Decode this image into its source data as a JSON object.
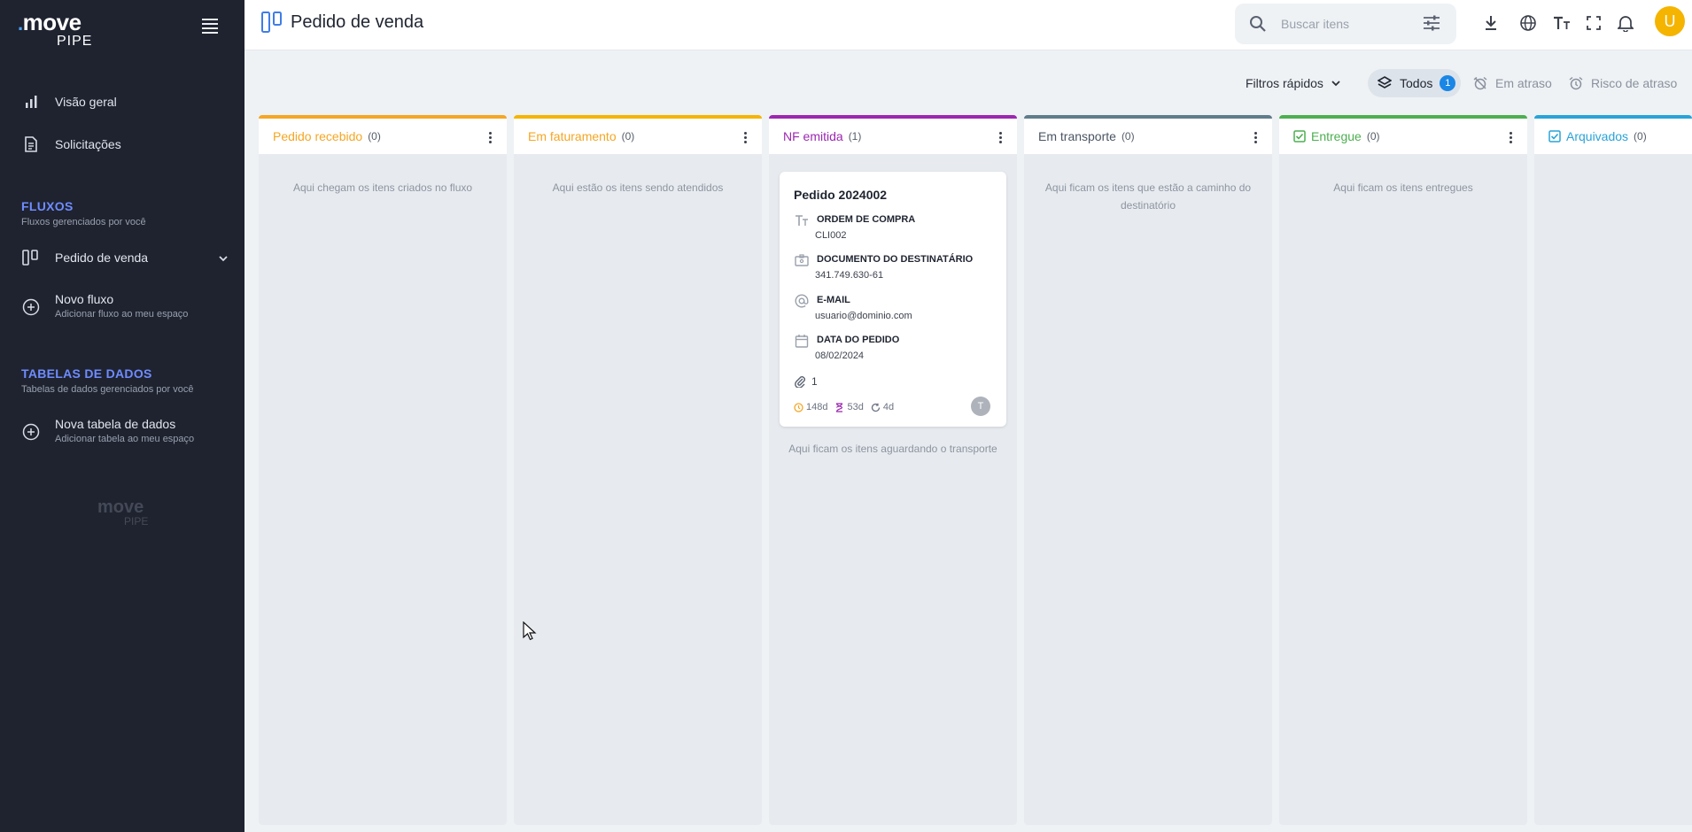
{
  "sidebar": {
    "logo_main": "move",
    "logo_sub": "PIPE",
    "nav": [
      {
        "label": "Visão geral",
        "icon": "bar-chart-icon"
      },
      {
        "label": "Solicitações",
        "icon": "document-icon"
      }
    ],
    "fluxos": {
      "title": "FLUXOS",
      "subtitle": "Fluxos gerenciados por você",
      "items": [
        {
          "label": "Pedido de venda",
          "icon": "kanban-icon"
        }
      ],
      "new": {
        "label": "Novo fluxo",
        "sub": "Adicionar fluxo ao meu espaço"
      }
    },
    "tabelas": {
      "title": "TABELAS DE DADOS",
      "subtitle": "Tabelas de dados gerenciados por você",
      "new": {
        "label": "Nova tabela de dados",
        "sub": "Adicionar tabela ao meu espaço"
      }
    },
    "footer_logo_main": "move",
    "footer_logo_sub": "PIPE"
  },
  "header": {
    "title": "Pedido de venda",
    "search_placeholder": "Buscar itens",
    "avatar_initial": "U"
  },
  "filters": {
    "quick_label": "Filtros rápidos",
    "chips": [
      {
        "label": "Todos",
        "count": "1",
        "active": true
      },
      {
        "label": "Em atraso",
        "active": false
      },
      {
        "label": "Risco de atraso",
        "active": false
      }
    ]
  },
  "columns": [
    {
      "title": "Pedido recebido",
      "count": "(0)",
      "color": "#f5a623",
      "empty_text": "Aqui chegam os itens criados no fluxo"
    },
    {
      "title": "Em faturamento",
      "count": "(0)",
      "color": "#f5b400",
      "empty_text": "Aqui estão os itens sendo atendidos"
    },
    {
      "title": "NF emitida",
      "count": "(1)",
      "color": "#9c27b0",
      "below_text": "Aqui ficam os itens aguardando o transporte"
    },
    {
      "title": "Em transporte",
      "count": "(0)",
      "color": "#607d8b",
      "empty_text": "Aqui ficam os itens que estão a caminho do destinatório"
    },
    {
      "title": "Entregue",
      "count": "(0)",
      "color": "#4caf50",
      "empty_text": "Aqui ficam os itens entregues"
    },
    {
      "title": "Arquivados",
      "count": "(0)",
      "color": "#29a3d8"
    }
  ],
  "card": {
    "title": "Pedido 2024002",
    "fields": [
      {
        "label": "ORDEM DE COMPRA",
        "value": "CLI002",
        "icon": "text-icon"
      },
      {
        "label": "DOCUMENTO DO DESTINATÁRIO",
        "value": "341.749.630-61",
        "icon": "id-card-icon"
      },
      {
        "label": "E-MAIL",
        "value": "usuario@dominio.com",
        "icon": "at-icon"
      },
      {
        "label": "DATA DO PEDIDO",
        "value": "08/02/2024",
        "icon": "calendar-icon"
      }
    ],
    "attachments": "1",
    "metrics": [
      "148d",
      "53d",
      "4d"
    ],
    "assignee_initial": "T"
  }
}
